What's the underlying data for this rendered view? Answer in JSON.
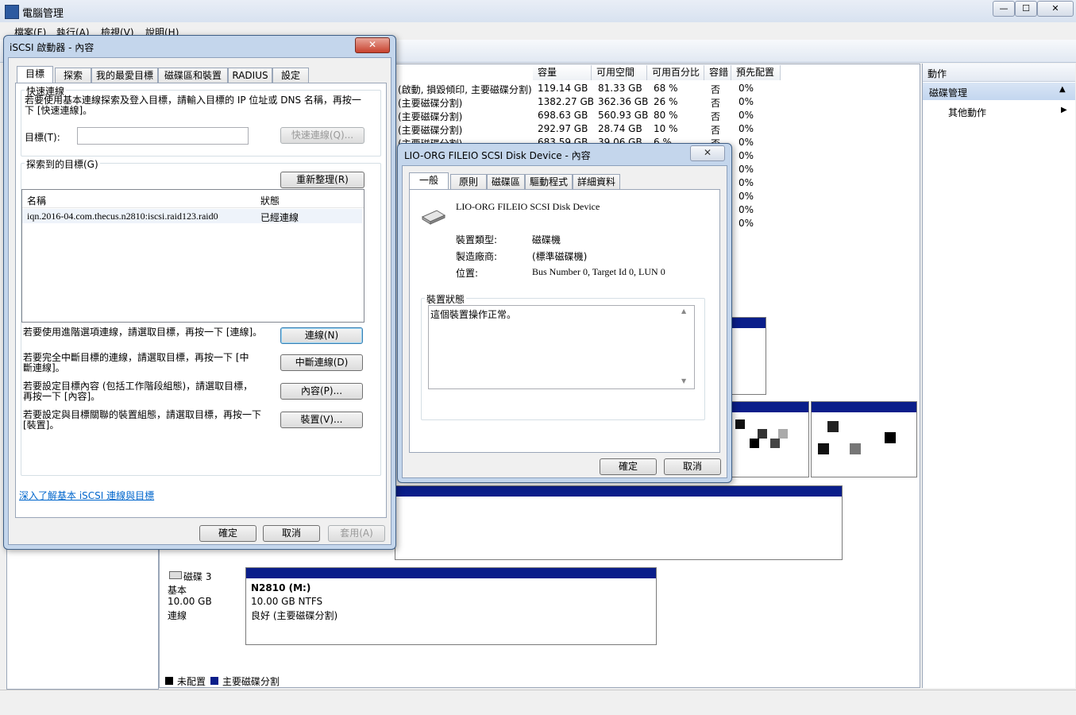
{
  "main_window": {
    "title": "電腦管理",
    "menu": [
      "檔案(F)",
      "執行(A)",
      "檢視(V)",
      "說明(H)"
    ],
    "volume_table": {
      "headers": [
        "容量",
        "可用空間",
        "可用百分比",
        "容錯",
        "預先配置"
      ],
      "rows": [
        {
          "layout": "(啟動, 損毀傾印, 主要磁碟分割)",
          "capacity": "119.14 GB",
          "free": "81.33 GB",
          "pct": "68 %",
          "fault": "否",
          "overhead": "0%"
        },
        {
          "layout": "(主要磁碟分割)",
          "capacity": "1382.27 GB",
          "free": "362.36 GB",
          "pct": "26 %",
          "fault": "否",
          "overhead": "0%"
        },
        {
          "layout": "(主要磁碟分割)",
          "capacity": "698.63 GB",
          "free": "560.93 GB",
          "pct": "80 %",
          "fault": "否",
          "overhead": "0%"
        },
        {
          "layout": "(主要磁碟分割)",
          "capacity": "292.97 GB",
          "free": "28.74 GB",
          "pct": "10 %",
          "fault": "否",
          "overhead": "0%"
        },
        {
          "layout": "(主要磁碟分割)",
          "capacity": "683.59 GB",
          "free": "39.06 GB",
          "pct": "6 %",
          "fault": "否",
          "overhead": "0%"
        }
      ],
      "extra_overhead": [
        "0%",
        "0%",
        "0%",
        "0%",
        "0%",
        "0%"
      ]
    },
    "actions": {
      "header": "動作",
      "section": "磁碟管理",
      "item": "其他動作"
    },
    "disk3": {
      "name": "磁碟 3",
      "type": "基本",
      "size": "10.00 GB",
      "status": "連線",
      "volume_name": "N2810  (M:)",
      "volume_size": "10.00 GB NTFS",
      "volume_status": "良好 (主要磁碟分割)"
    },
    "legend": {
      "unallocated": "未配置",
      "primary": "主要磁碟分割",
      "unallocated_color": "#000000",
      "primary_color": "#0a1e8a"
    }
  },
  "iscsi_dialog": {
    "title": "iSCSI 啟動器 - 內容",
    "tabs": [
      "目標",
      "探索",
      "我的最愛目標",
      "磁碟區和裝置",
      "RADIUS",
      "設定"
    ],
    "quick_connect_label": "快速連線",
    "quick_connect_desc": "若要使用基本連線探索及登入目標，請輸入目標的 IP 位址或 DNS 名稱，再按一下 [快速連線]。",
    "target_label": "目標(T):",
    "target_value": "",
    "quick_connect_button": "快速連線(Q)...",
    "discovered_label": "探索到的目標(G)",
    "refresh_button": "重新整理(R)",
    "table_headers": [
      "名稱",
      "狀態"
    ],
    "targets": [
      {
        "name": "iqn.2016-04.com.thecus.n2810:iscsi.raid123.raid0",
        "status": "已經連線"
      }
    ],
    "connect_desc": "若要使用進階選項連線，請選取目標，再按一下 [連線]。",
    "connect_button": "連線(N)",
    "disconnect_desc": "若要完全中斷目標的連線，請選取目標，再按一下 [中斷連線]。",
    "disconnect_button": "中斷連線(D)",
    "properties_desc": "若要設定目標內容 (包括工作階段組態)，請選取目標，再按一下 [內容]。",
    "properties_button": "內容(P)...",
    "devices_desc": "若要設定與目標關聯的裝置組態，請選取目標，再按一下 [裝置]。",
    "devices_button": "裝置(V)...",
    "learn_more_link": "深入了解基本 iSCSI 連線與目標",
    "ok": "確定",
    "cancel": "取消",
    "apply": "套用(A)"
  },
  "device_dialog": {
    "title": "LIO-ORG FILEIO SCSI Disk Device - 內容",
    "tabs": [
      "一般",
      "原則",
      "磁碟區",
      "驅動程式",
      "詳細資料"
    ],
    "device_name": "LIO-ORG FILEIO SCSI Disk Device",
    "type_label": "裝置類型:",
    "type_value": "磁碟機",
    "manufacturer_label": "製造廠商:",
    "manufacturer_value": "(標準磁碟機)",
    "location_label": "位置:",
    "location_value": "Bus Number 0, Target Id 0, LUN 0",
    "status_label": "裝置狀態",
    "status_text": "這個裝置操作正常。",
    "ok": "確定",
    "cancel": "取消"
  }
}
